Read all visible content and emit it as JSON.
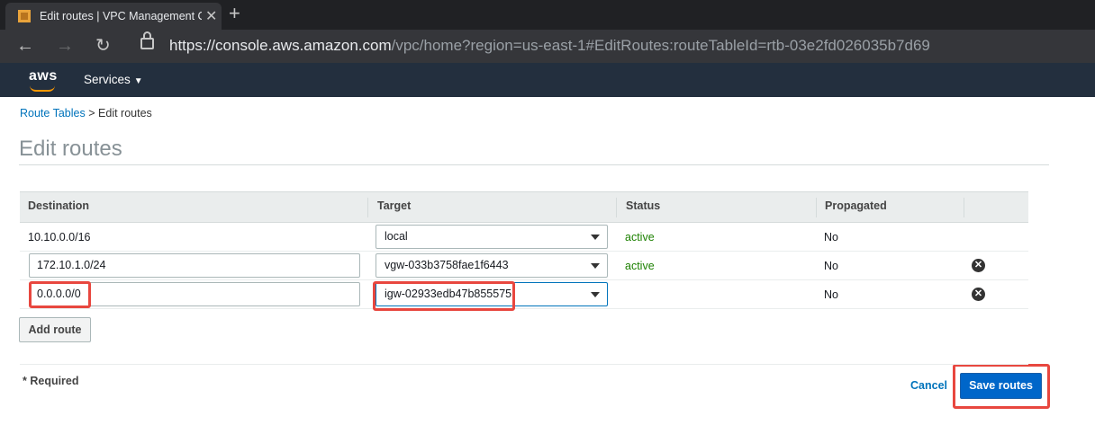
{
  "browser": {
    "tab_title": "Edit routes | VPC Management C",
    "tab_close": "✕",
    "new_tab": "+",
    "url_scheme": "https://",
    "url_host": "console.aws.amazon.com",
    "url_path": "/vpc/home?region=us-east-1#EditRoutes:routeTableId=rtb-03e2fd026035b7d69"
  },
  "aws_header": {
    "logo": "aws",
    "services_label": "Services"
  },
  "breadcrumb": {
    "parent": "Route Tables",
    "separator": ">",
    "current": "Edit routes"
  },
  "page_title": "Edit routes",
  "table": {
    "headers": [
      "Destination",
      "Target",
      "Status",
      "Propagated"
    ],
    "rows": [
      {
        "destination": "10.10.0.0/16",
        "target": "local",
        "status": "active",
        "propagated": "No"
      },
      {
        "destination": "172.10.1.0/24",
        "target": "vgw-033b3758fae1f6443",
        "status": "active",
        "propagated": "No"
      },
      {
        "destination": "0.0.0.0/0",
        "target": "igw-02933edb47b855575",
        "status": "",
        "propagated": "No"
      }
    ]
  },
  "add_route_label": "Add route",
  "required_note": "* Required",
  "cancel_label": "Cancel",
  "save_label": "Save routes",
  "colors": {
    "aws_header_bg": "#232f3e",
    "link": "#0073bb",
    "status_active": "#1d8102",
    "primary_button": "#0066c9",
    "highlight": "#e8473f"
  }
}
